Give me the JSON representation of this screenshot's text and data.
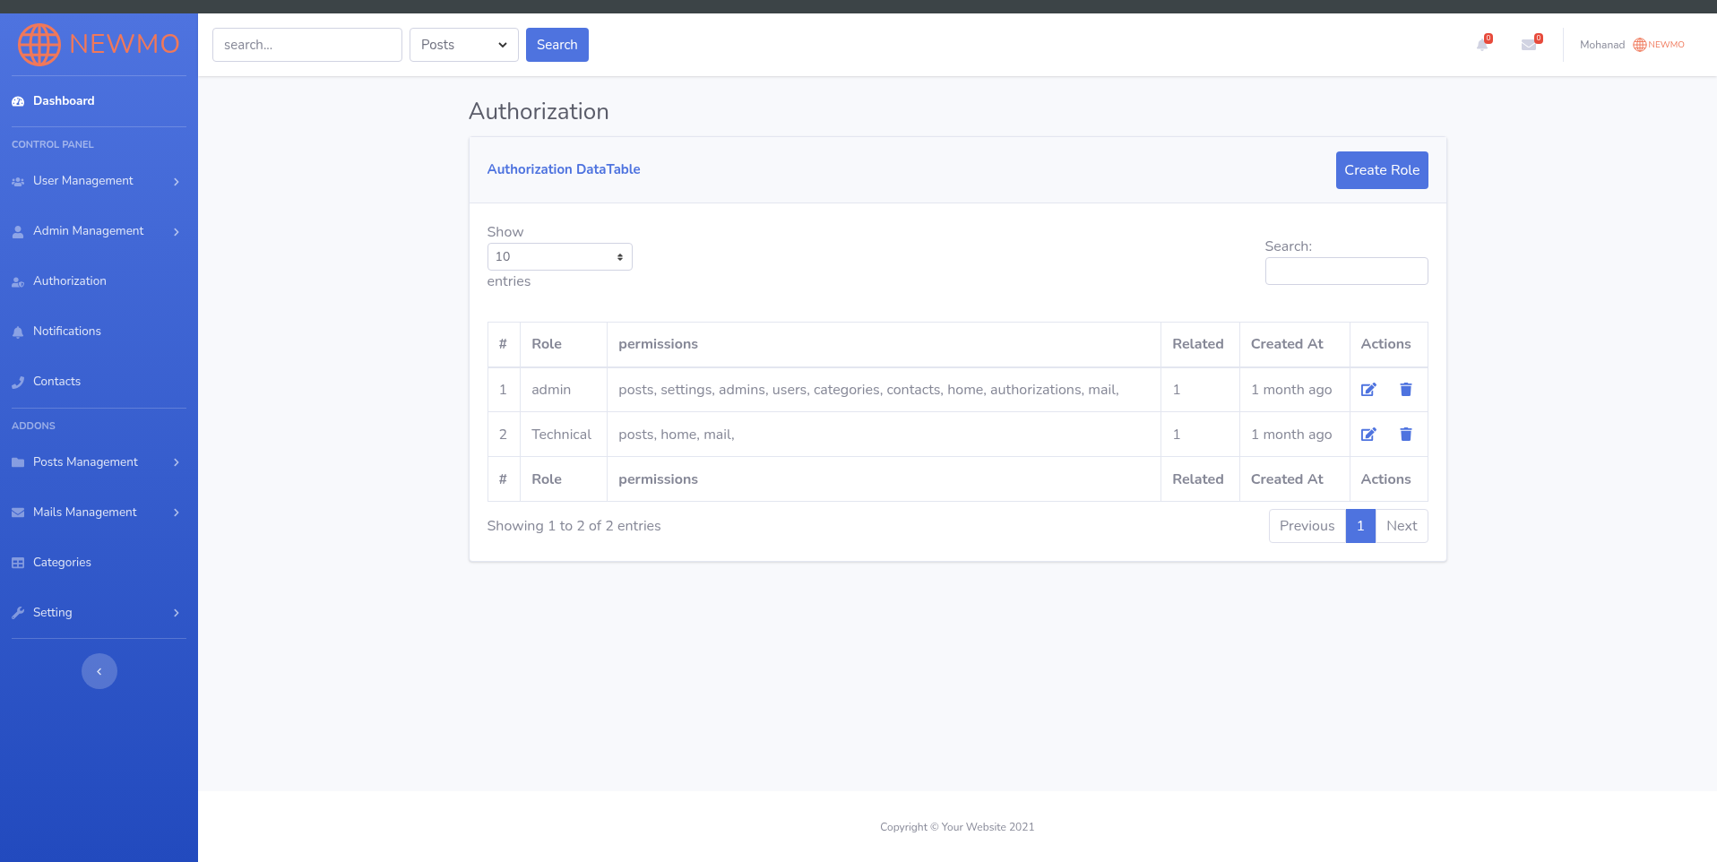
{
  "sidebar": {
    "brand": "NEWMO",
    "sections": [
      {
        "items": [
          {
            "label": "Dashboard",
            "selected": true,
            "submenu": false
          }
        ]
      },
      {
        "heading": "CONTROL PANEL",
        "items": [
          {
            "label": "User Management",
            "selected": false,
            "submenu": true
          },
          {
            "label": "Admin Management",
            "selected": false,
            "submenu": true
          },
          {
            "label": "Authorization",
            "selected": false,
            "submenu": false
          },
          {
            "label": "Notifications",
            "selected": false,
            "submenu": false
          },
          {
            "label": "Contacts",
            "selected": false,
            "submenu": false
          }
        ]
      },
      {
        "heading": "ADDONS",
        "items": [
          {
            "label": "Posts Management",
            "selected": false,
            "submenu": true
          },
          {
            "label": "Mails Management",
            "selected": false,
            "submenu": true
          },
          {
            "label": "Categories",
            "selected": false,
            "submenu": false
          },
          {
            "label": "Setting",
            "selected": false,
            "submenu": true
          }
        ]
      }
    ]
  },
  "topbar": {
    "search": {
      "placeholder": "search..."
    },
    "scope": "Posts",
    "search_button": "Search",
    "notifications_count": "0",
    "messages_count": "0",
    "user_name": "Mohanad",
    "user_brand": "NEWMO"
  },
  "page": {
    "title": "Authorization",
    "card": {
      "title": "Authorization DataTable",
      "create_button": "Create Role",
      "length": {
        "show": "Show",
        "value": "10",
        "entries": "entries"
      },
      "search_label": "Search:",
      "table": {
        "columns": [
          "#",
          "Role",
          "permissions",
          "Related",
          "Created At",
          "Actions"
        ],
        "rows": [
          {
            "cells": [
              "1",
              "admin",
              "posts, settings, admins, users, categories, contacts, home, authorizations, mail,",
              "1",
              "1 month ago"
            ]
          },
          {
            "cells": [
              "2",
              "Technical",
              "posts, home, mail,",
              "1",
              "1 month ago"
            ]
          }
        ],
        "footer": [
          "#",
          "Role",
          "permissions",
          "Related",
          "Created At",
          "Actions"
        ]
      },
      "info": "Showing 1 to 2 of 2 entries",
      "pagination": [
        {
          "label": "Previous",
          "selected": false
        },
        {
          "label": "1",
          "selected": true
        },
        {
          "label": "Next",
          "selected": false
        }
      ]
    }
  },
  "footer": "Copyright © Your Website 2021"
}
